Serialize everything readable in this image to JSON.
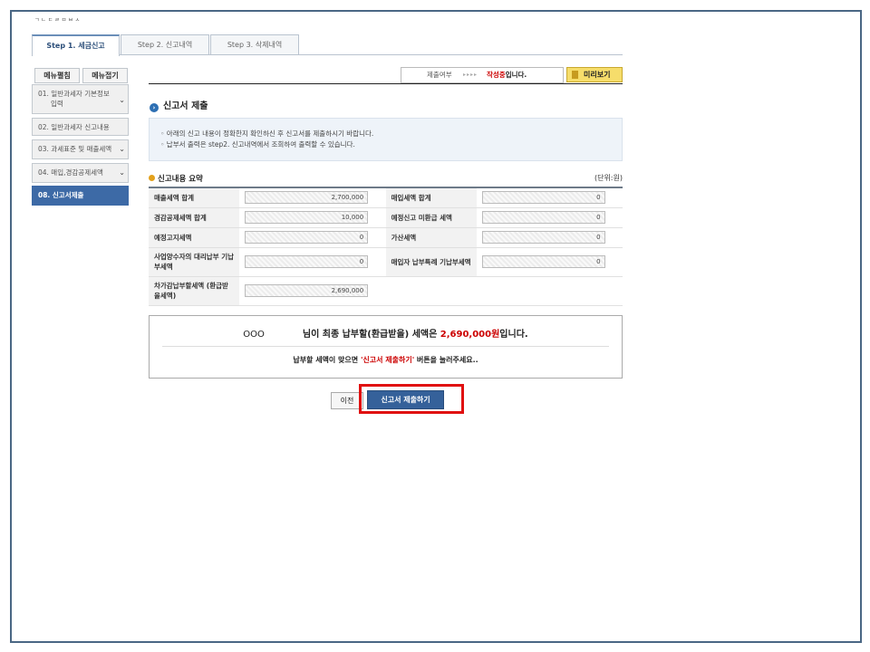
{
  "header": {
    "small_text": "ㄱ ㄴ ㄷ ㄹ ㅁ ㅂ ㅅ"
  },
  "tabs": [
    {
      "label": "Step 1. 세금신고"
    },
    {
      "label": "Step 2. 신고내역"
    },
    {
      "label": "Step 3. 삭제내역"
    }
  ],
  "sidebar": {
    "expand_label": "메뉴펼침",
    "collapse_label": "메뉴접기",
    "items": [
      {
        "label": "01. 일반과세자 기본정보",
        "label2": "입력"
      },
      {
        "label": "02. 일반과세자 신고내용"
      },
      {
        "label": "03. 과세표준 및 매출세액"
      },
      {
        "label": "04. 매입,경감공제세액"
      },
      {
        "label": "08. 신고서제출"
      }
    ]
  },
  "status": {
    "label": "제출여부",
    "arrows": "▸▸▸▸",
    "value": "작성중",
    "suffix": "입니다.",
    "preview_label": "미리보기"
  },
  "section": {
    "title": "신고서 제출"
  },
  "info": {
    "line1": "◦ 아래의 신고 내용이 정확한지 확인하신 후 신고서를 제출하시기 바랍니다.",
    "line2": "◦ 납부서 출력은 step2. 신고내역에서 조회하여 출력할 수 있습니다."
  },
  "summary": {
    "title": "신고내용 요약",
    "unit": "(단위:원)",
    "rows": [
      {
        "l1": "매출세액 합계",
        "v1": "2,700,000",
        "l2": "매입세액 합계",
        "v2": "0"
      },
      {
        "l1": "경감공제세액 합계",
        "v1": "10,000",
        "l2": "예정신고 미환급 세액",
        "v2": "0"
      },
      {
        "l1": "예정고지세액",
        "v1": "0",
        "l2": "가산세액",
        "v2": "0"
      },
      {
        "l1": "사업양수자의 대리납부 기납부세액",
        "v1": "0",
        "l2": "매입자 납부특례 기납부세액",
        "v2": "0"
      },
      {
        "l1": "차가감납부할세액 (환급받을세액)",
        "v1": "2,690,000"
      }
    ]
  },
  "result": {
    "name": "OOO",
    "text1": "님이 최종 납부할(환급받을) 세액은 ",
    "amount": "2,690,000원",
    "text2": "입니다.",
    "confirm1": "납부할 세액이 맞으면 ",
    "confirm_quote": "'신고서 제출하기'",
    "confirm2": " 버튼을 눌러주세요.."
  },
  "buttons": {
    "prev_label": "이전",
    "submit_label": "신고서 제출하기"
  },
  "colors": {
    "accent": "#35619a",
    "highlight": "#e01010",
    "amount": "#cc0000"
  }
}
